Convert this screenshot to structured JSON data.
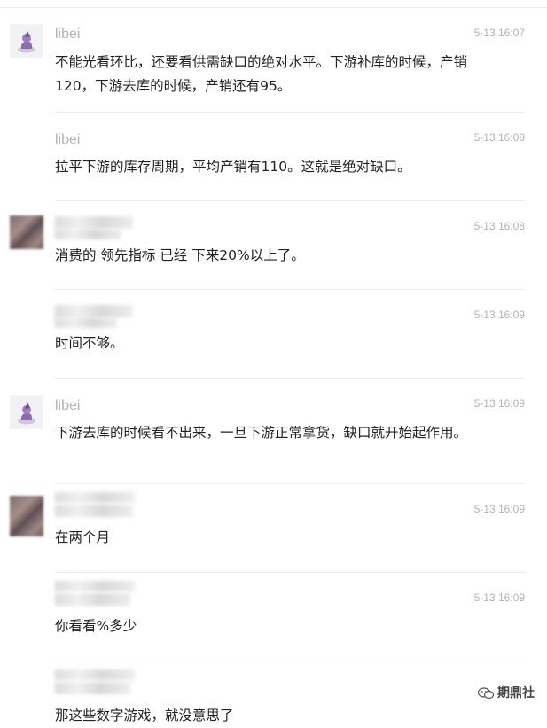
{
  "messages": [
    {
      "name": "libei",
      "time": "5-13 16:07",
      "text": "不能光看环比，还要看供需缺口的绝对水平。下游补库的时候，产销120，下游去库的时候，产销还有95。"
    },
    {
      "name": "libei",
      "time": "5-13 16:08",
      "text": "拉平下游的库存周期，平均产销有110。这就是绝对缺口。"
    },
    {
      "name": "",
      "time": "5-13 16:08",
      "text": "消费的 领先指标 已经 下来20%以上了。"
    },
    {
      "name": "",
      "time": "5-13 16:09",
      "text": "时间不够。"
    },
    {
      "name": "libei",
      "time": "5-13 16:09",
      "text": "下游去库的时候看不出来，一旦下游正常拿货，缺口就开始起作用。"
    },
    {
      "name": "",
      "time": "5-13 16:09",
      "text": "在两个月"
    },
    {
      "name": "",
      "time": "5-13 16:09",
      "text": "你看看%多少"
    }
  ],
  "last_message_text": "那这些数字游戏，就没意思了",
  "watermark": {
    "label": "期鼎社"
  }
}
